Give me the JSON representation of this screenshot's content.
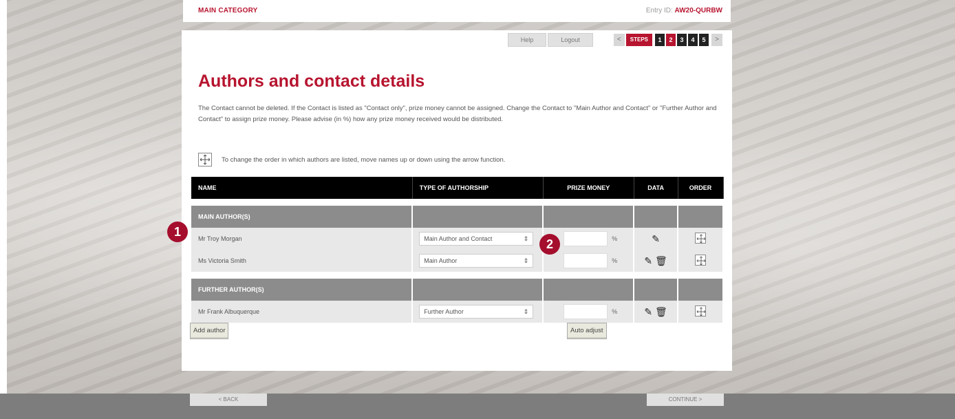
{
  "header": {
    "category": "MAIN CATEGORY",
    "entry_label": "Entry ID:",
    "entry_id": "AW20-QURBW"
  },
  "nav": {
    "help": "Help",
    "logout": "Logout",
    "prev": "<",
    "next": ">",
    "steps_label": "STEPS",
    "steps": [
      "1",
      "2",
      "3",
      "4",
      "5"
    ],
    "active_step": "2"
  },
  "page": {
    "title": "Authors and contact details",
    "description": "The Contact cannot be deleted. If the Contact is listed as \"Contact only\", prize money cannot be assigned. Change the Contact to \"Main Author and Contact\" or \"Further Author and Contact\" to assign prize money. Please advise (in %) how any prize money received would be distributed.",
    "hint": "To change the order in which authors are listed, move names up or down using the arrow function."
  },
  "table": {
    "headers": {
      "name": "NAME",
      "type": "TYPE OF AUTHORSHIP",
      "prize": "PRIZE MONEY",
      "data": "DATA",
      "order": "ORDER"
    },
    "main_group": "MAIN AUTHOR(S)",
    "main_rows": [
      {
        "name": "Mr Troy Morgan",
        "type": "Main Author and Contact",
        "percent": "%"
      },
      {
        "name": "Ms Victoria Smith",
        "type": "Main Author",
        "percent": "%"
      }
    ],
    "further_group": "FURTHER AUTHOR(S)",
    "further_rows": [
      {
        "name": "Mr Frank Albuquerque",
        "type": "Further Author",
        "percent": "%"
      }
    ]
  },
  "buttons": {
    "add_author": "Add author",
    "auto_adjust": "Auto adjust"
  },
  "markers": [
    "1",
    "2"
  ],
  "footer": {
    "back": "< BACK",
    "continue": "CONTINUE >"
  },
  "colors": {
    "accent": "#b7142f",
    "header_bg": "#000000",
    "group_bg": "#8c8c8c"
  }
}
